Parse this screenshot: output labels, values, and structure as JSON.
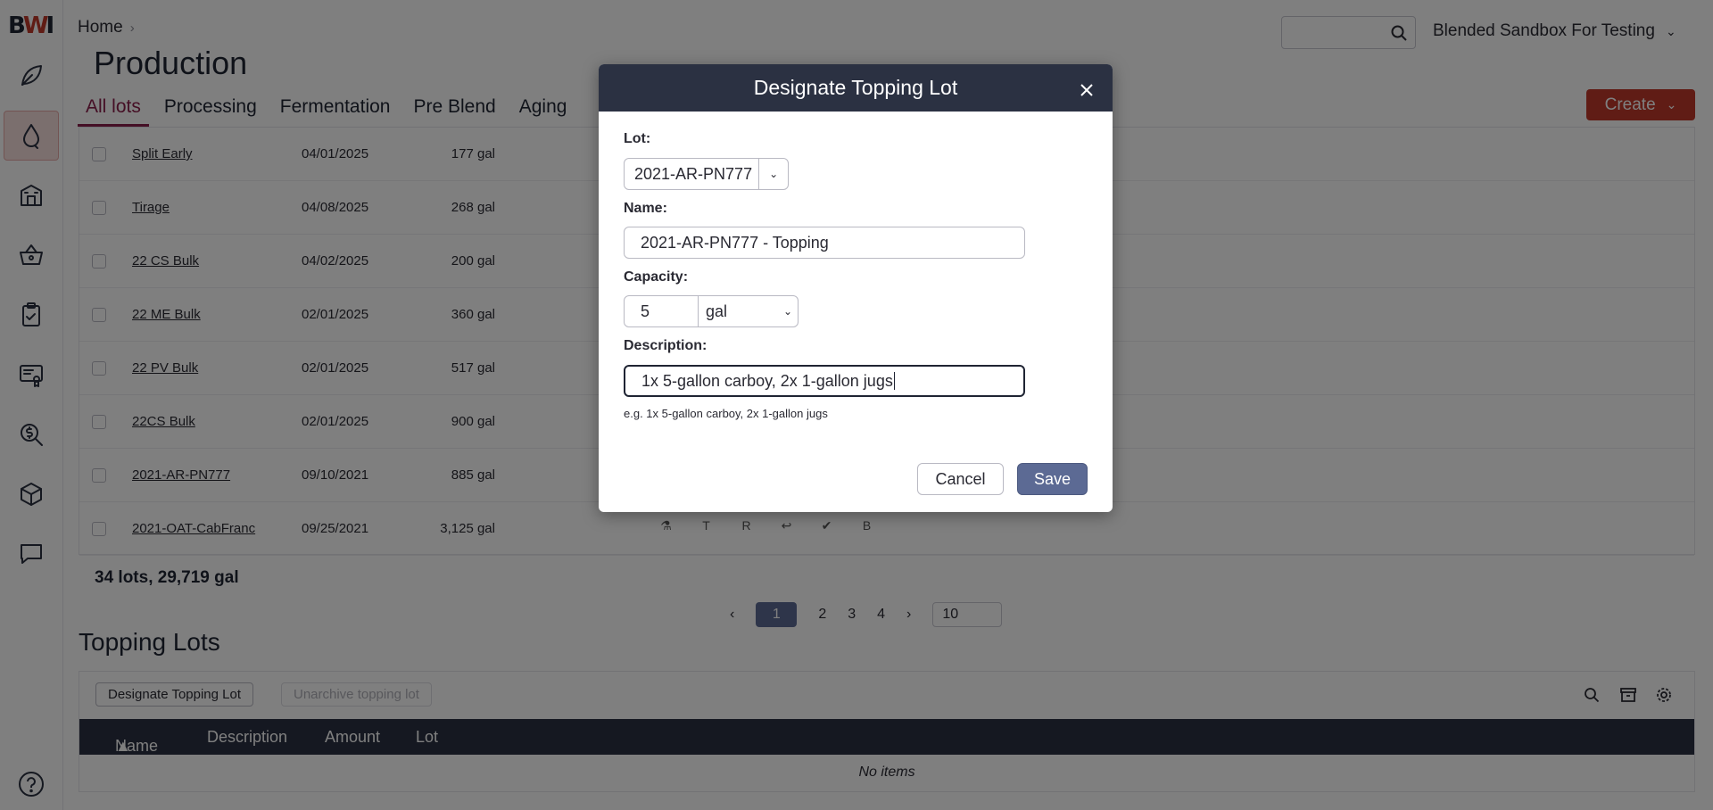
{
  "breadcrumb": {
    "home": "Home",
    "sep": "›"
  },
  "page": {
    "title": "Production"
  },
  "search": {
    "placeholder": ""
  },
  "account": {
    "name": "Blended Sandbox For Testing"
  },
  "tabs": [
    "All lots",
    "Processing",
    "Fermentation",
    "Pre Blend",
    "Aging"
  ],
  "create_button": "Create",
  "lots": [
    {
      "name": "Split Early",
      "date": "04/01/2025",
      "volume": "177 gal"
    },
    {
      "name": "Tirage",
      "date": "04/08/2025",
      "volume": "268 gal"
    },
    {
      "name": "22 CS Bulk",
      "date": "04/02/2025",
      "volume": "200 gal"
    },
    {
      "name": "22 ME Bulk",
      "date": "02/01/2025",
      "volume": "360 gal"
    },
    {
      "name": "22 PV Bulk",
      "date": "02/01/2025",
      "volume": "517 gal"
    },
    {
      "name": "22CS Bulk",
      "date": "02/01/2025",
      "volume": "900 gal"
    },
    {
      "name": "2021-AR-PN777",
      "date": "09/10/2021",
      "volume": "885 gal"
    },
    {
      "name": "2021-OAT-CabFranc",
      "date": "09/25/2021",
      "volume": "3,125 gal"
    }
  ],
  "row_icons": {
    "a": "90",
    "b": "T",
    "c": "21",
    "d": "R",
    "e": "B"
  },
  "totals": "34 lots, 29,719 gal",
  "pager": {
    "p1": "1",
    "p2": "2",
    "p3": "3",
    "p4": "4",
    "size": "10"
  },
  "topping": {
    "title": "Topping Lots",
    "designate_button": "Designate Topping Lot",
    "unarchive_button": "Unarchive topping lot",
    "columns": [
      "Name",
      "Description",
      "Amount",
      "Lot"
    ],
    "empty": "No items"
  },
  "modal": {
    "title": "Designate Topping Lot",
    "lot_label": "Lot:",
    "lot_value": "2021-AR-PN777",
    "name_label": "Name:",
    "name_value": "2021-AR-PN777 - Topping",
    "capacity_label": "Capacity:",
    "capacity_value": "5",
    "unit_value": "gal",
    "description_label": "Description:",
    "description_value": "1x 5-gallon carboy, 2x 1-gallon jugs",
    "hint": "e.g. 1x 5-gallon carboy, 2x 1-gallon jugs",
    "cancel": "Cancel",
    "save": "Save"
  },
  "colors": {
    "accent": "#c0392b",
    "primary": "#5c6a94",
    "header": "#2b3142",
    "active_tab": "#8a1e4a"
  }
}
